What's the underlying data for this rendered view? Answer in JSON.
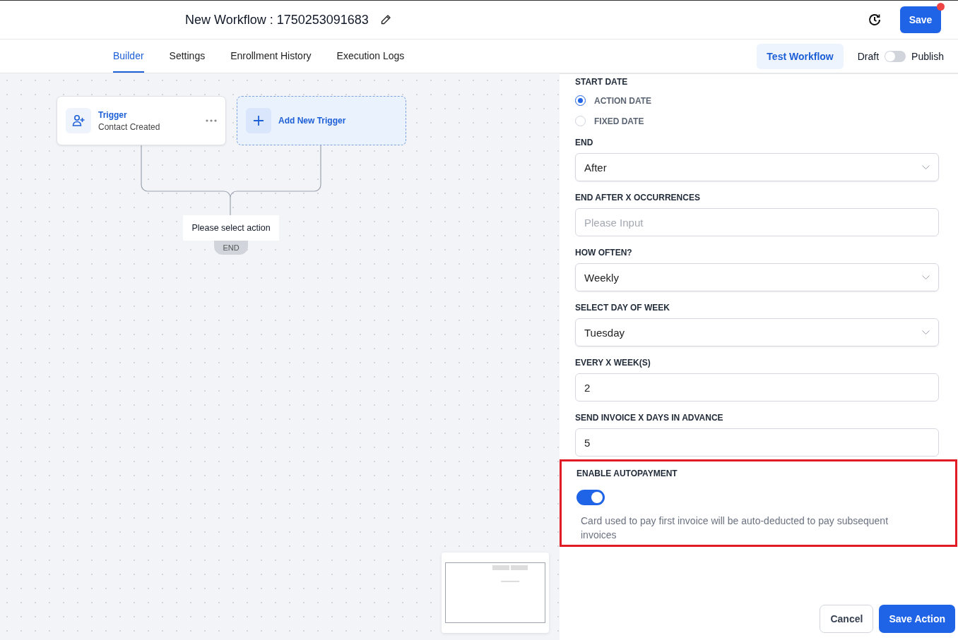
{
  "header": {
    "title": "New Workflow : 1750253091683",
    "save_label": "Save",
    "unsaved": true
  },
  "tabs": [
    {
      "label": "Builder",
      "selected": true
    },
    {
      "label": "Settings",
      "selected": false
    },
    {
      "label": "Enrollment History",
      "selected": false
    },
    {
      "label": "Execution Logs",
      "selected": false
    }
  ],
  "test_button": "Test Workflow",
  "publish": {
    "off_label": "Draft",
    "on_label": "Publish",
    "on": false
  },
  "canvas": {
    "trigger": {
      "title": "Trigger",
      "subtitle": "Contact Created"
    },
    "add_trigger": "Add New Trigger",
    "action_placeholder": "Please select action",
    "end_label": "END"
  },
  "panel": {
    "fields": [
      {
        "kind": "radio",
        "label": "START DATE",
        "options": [
          {
            "label": "ACTION DATE",
            "selected": true
          },
          {
            "label": "FIXED DATE",
            "selected": false
          }
        ]
      },
      {
        "kind": "select",
        "label": "END",
        "value": "After"
      },
      {
        "kind": "input",
        "label": "END AFTER X OCCURRENCES",
        "placeholder": "Please Input"
      },
      {
        "kind": "select",
        "label": "HOW OFTEN?",
        "value": "Weekly"
      },
      {
        "kind": "select",
        "label": "SELECT DAY OF WEEK",
        "value": "Tuesday"
      },
      {
        "kind": "input",
        "label": "EVERY X WEEK(S)",
        "value": "2"
      },
      {
        "kind": "input",
        "label": "SEND INVOICE X DAYS IN ADVANCE",
        "value": "5"
      },
      {
        "kind": "toggle",
        "label": "ENABLE AUTOPAYMENT",
        "on": true,
        "help": "Card used to pay first invoice will be auto-deducted to pay subsequent invoices",
        "highlighted": true
      }
    ],
    "cancel_label": "Cancel",
    "save_label": "Save Action"
  }
}
